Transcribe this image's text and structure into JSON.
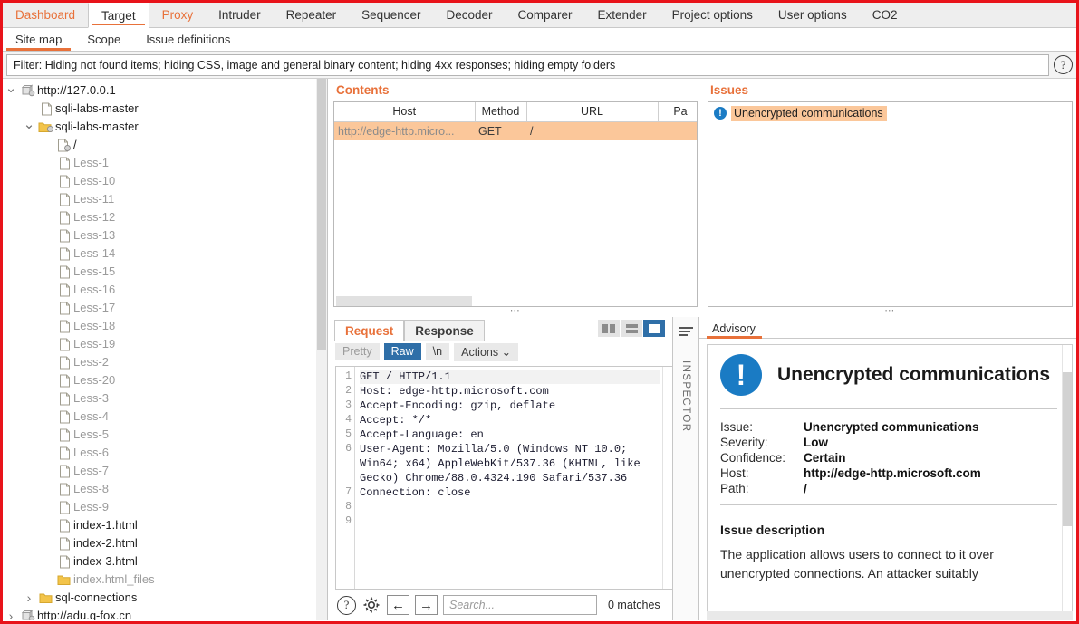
{
  "main_tabs": [
    {
      "label": "Dashboard",
      "style": "orange"
    },
    {
      "label": "Target",
      "style": "active"
    },
    {
      "label": "Proxy",
      "style": "orange"
    },
    {
      "label": "Intruder",
      "style": "normal"
    },
    {
      "label": "Repeater",
      "style": "normal"
    },
    {
      "label": "Sequencer",
      "style": "normal"
    },
    {
      "label": "Decoder",
      "style": "normal"
    },
    {
      "label": "Comparer",
      "style": "normal"
    },
    {
      "label": "Extender",
      "style": "normal"
    },
    {
      "label": "Project options",
      "style": "normal"
    },
    {
      "label": "User options",
      "style": "normal"
    },
    {
      "label": "CO2",
      "style": "normal"
    }
  ],
  "sub_tabs": [
    {
      "label": "Site map",
      "active": true
    },
    {
      "label": "Scope",
      "active": false
    },
    {
      "label": "Issue definitions",
      "active": false
    }
  ],
  "filter": {
    "text": "Filter: Hiding not found items;  hiding CSS, image and general binary content;  hiding 4xx responses;  hiding empty folders",
    "help_icon": "question-mark-icon",
    "help_label": "?"
  },
  "tree": {
    "items": [
      {
        "label": "http://127.0.0.1",
        "indent": 0,
        "twist": "down",
        "icon": "server-icon",
        "tone": "dark"
      },
      {
        "label": "sqli-labs-master",
        "indent": 1,
        "twist": "none",
        "icon": "page-icon",
        "tone": "dark"
      },
      {
        "label": "sqli-labs-master",
        "indent": 1,
        "twist": "down",
        "icon": "folder-globe-icon",
        "tone": "dark"
      },
      {
        "label": "/",
        "indent": 2,
        "twist": "none",
        "icon": "page-globe-icon",
        "tone": "dark"
      },
      {
        "label": "Less-1",
        "indent": 2,
        "twist": "none",
        "icon": "page-icon",
        "tone": "gray"
      },
      {
        "label": "Less-10",
        "indent": 2,
        "twist": "none",
        "icon": "page-icon",
        "tone": "gray"
      },
      {
        "label": "Less-11",
        "indent": 2,
        "twist": "none",
        "icon": "page-icon",
        "tone": "gray"
      },
      {
        "label": "Less-12",
        "indent": 2,
        "twist": "none",
        "icon": "page-icon",
        "tone": "gray"
      },
      {
        "label": "Less-13",
        "indent": 2,
        "twist": "none",
        "icon": "page-icon",
        "tone": "gray"
      },
      {
        "label": "Less-14",
        "indent": 2,
        "twist": "none",
        "icon": "page-icon",
        "tone": "gray"
      },
      {
        "label": "Less-15",
        "indent": 2,
        "twist": "none",
        "icon": "page-icon",
        "tone": "gray"
      },
      {
        "label": "Less-16",
        "indent": 2,
        "twist": "none",
        "icon": "page-icon",
        "tone": "gray"
      },
      {
        "label": "Less-17",
        "indent": 2,
        "twist": "none",
        "icon": "page-icon",
        "tone": "gray"
      },
      {
        "label": "Less-18",
        "indent": 2,
        "twist": "none",
        "icon": "page-icon",
        "tone": "gray"
      },
      {
        "label": "Less-19",
        "indent": 2,
        "twist": "none",
        "icon": "page-icon",
        "tone": "gray"
      },
      {
        "label": "Less-2",
        "indent": 2,
        "twist": "none",
        "icon": "page-icon",
        "tone": "gray"
      },
      {
        "label": "Less-20",
        "indent": 2,
        "twist": "none",
        "icon": "page-icon",
        "tone": "gray"
      },
      {
        "label": "Less-3",
        "indent": 2,
        "twist": "none",
        "icon": "page-icon",
        "tone": "gray"
      },
      {
        "label": "Less-4",
        "indent": 2,
        "twist": "none",
        "icon": "page-icon",
        "tone": "gray"
      },
      {
        "label": "Less-5",
        "indent": 2,
        "twist": "none",
        "icon": "page-icon",
        "tone": "gray"
      },
      {
        "label": "Less-6",
        "indent": 2,
        "twist": "none",
        "icon": "page-icon",
        "tone": "gray"
      },
      {
        "label": "Less-7",
        "indent": 2,
        "twist": "none",
        "icon": "page-icon",
        "tone": "gray"
      },
      {
        "label": "Less-8",
        "indent": 2,
        "twist": "none",
        "icon": "page-icon",
        "tone": "gray"
      },
      {
        "label": "Less-9",
        "indent": 2,
        "twist": "none",
        "icon": "page-icon",
        "tone": "gray"
      },
      {
        "label": "index-1.html",
        "indent": 2,
        "twist": "none",
        "icon": "page-icon",
        "tone": "dark"
      },
      {
        "label": "index-2.html",
        "indent": 2,
        "twist": "none",
        "icon": "page-icon",
        "tone": "dark"
      },
      {
        "label": "index-3.html",
        "indent": 2,
        "twist": "none",
        "icon": "page-icon",
        "tone": "dark"
      },
      {
        "label": "index.html_files",
        "indent": 2,
        "twist": "none",
        "icon": "folder-icon",
        "tone": "gray"
      },
      {
        "label": "sql-connections",
        "indent": 1,
        "twist": "right",
        "icon": "folder-icon",
        "tone": "dark"
      },
      {
        "label": "http://adu.q-fox.cn",
        "indent": 0,
        "twist": "right",
        "icon": "server-icon",
        "tone": "dark"
      }
    ]
  },
  "contents": {
    "title": "Contents",
    "columns": [
      "Host",
      "Method",
      "URL",
      "Pa"
    ],
    "rows": [
      {
        "host": "http://edge-http.micro...",
        "method": "GET",
        "url": "/",
        "params": "",
        "selected": true
      }
    ]
  },
  "issues": {
    "title": "Issues",
    "rows": [
      {
        "label": "Unencrypted communications",
        "icon": "info-icon",
        "selected": true
      }
    ]
  },
  "request_panel": {
    "tabs": [
      {
        "label": "Request",
        "active": true
      },
      {
        "label": "Response",
        "active": false
      }
    ],
    "view_buttons": [
      {
        "name": "split-vertical-icon",
        "selected": false
      },
      {
        "name": "split-horizontal-icon",
        "selected": false
      },
      {
        "name": "single-pane-icon",
        "selected": true
      }
    ],
    "toolbar": [
      {
        "label": "Pretty",
        "state": "off"
      },
      {
        "label": "Raw",
        "state": "on"
      },
      {
        "label": "\\n",
        "state": "dark"
      },
      {
        "label": "Actions",
        "state": "dark",
        "caret": "⌄"
      }
    ],
    "line_numbers": [
      "1",
      "2",
      "3",
      "4",
      "5",
      "6",
      "7",
      "8",
      "9"
    ],
    "lines": [
      "GET / HTTP/1.1",
      "Host: edge-http.microsoft.com",
      "Accept-Encoding: gzip, deflate",
      "Accept: */*",
      "Accept-Language: en",
      "User-Agent: Mozilla/5.0 (Windows NT 10.0; Win64; x64) AppleWebKit/537.36 (KHTML, like Gecko) Chrome/88.0.4324.190 Safari/537.36",
      "Connection: close",
      "",
      ""
    ],
    "footer": {
      "help_label": "?",
      "help_icon": "question-mark-icon",
      "settings_icon": "gear-icon",
      "prev_icon": "arrow-left-icon",
      "prev_label": "←",
      "next_icon": "arrow-right-icon",
      "next_label": "→",
      "search_placeholder": "Search...",
      "search_value": "",
      "matches": "0 matches"
    }
  },
  "inspector": {
    "label": "INSPECTOR",
    "icon": "inspector-lines-icon"
  },
  "advisory": {
    "tabs": [
      {
        "label": "Advisory",
        "active": true
      }
    ],
    "icon": "info-icon",
    "title": "Unencrypted communications",
    "fields": [
      {
        "key": "Issue:",
        "value": "Unencrypted communications"
      },
      {
        "key": "Severity:",
        "value": "Low"
      },
      {
        "key": "Confidence:",
        "value": "Certain"
      },
      {
        "key": "Host:",
        "value": "http://edge-http.microsoft.com"
      },
      {
        "key": "Path:",
        "value": "/"
      }
    ],
    "description_heading": "Issue description",
    "description_text": "The application allows users to connect to it over unencrypted connections. An attacker suitably"
  },
  "colors": {
    "accent_orange": "#e8713a",
    "selection_orange": "#fbc79a",
    "info_blue": "#1a7bc4",
    "border_red": "#e8131a",
    "toolbar_blue": "#2f6fa8"
  }
}
